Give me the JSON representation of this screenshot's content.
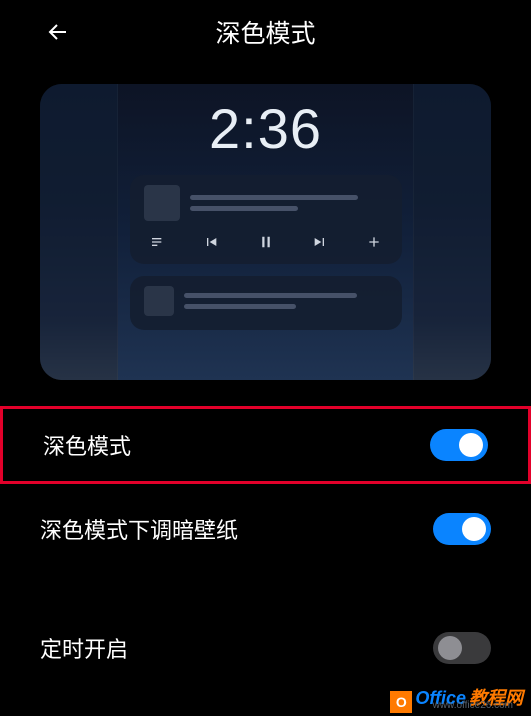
{
  "header": {
    "title": "深色模式"
  },
  "preview": {
    "clock": "2:36"
  },
  "settings": {
    "dark_mode": {
      "label": "深色模式",
      "value": true
    },
    "dim_wallpaper": {
      "label": "深色模式下调暗壁纸",
      "value": true
    },
    "schedule": {
      "label": "定时开启",
      "value": false
    }
  },
  "watermark": {
    "logo_letter": "O",
    "brand_a": "Office",
    "brand_b": "教程网",
    "url": "www.office26.com"
  }
}
